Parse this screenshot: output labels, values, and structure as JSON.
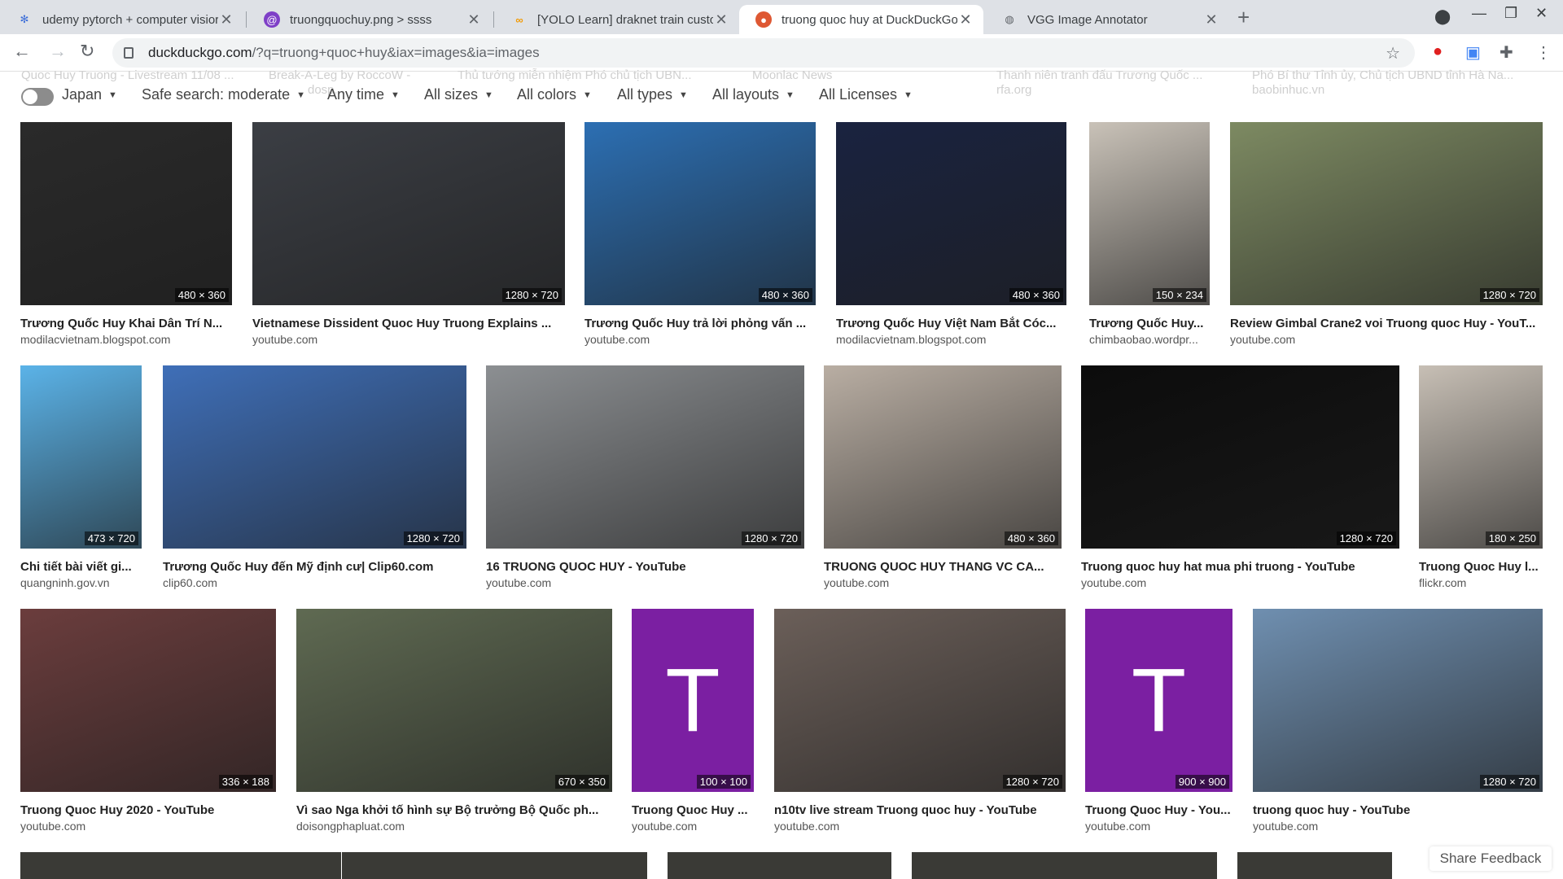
{
  "tabs": [
    {
      "title": "udemy pytorch + computer visior",
      "icon": "gear-icon"
    },
    {
      "title": "truongquochuy.png > ssss",
      "icon": "swirl-icon"
    },
    {
      "title": "[YOLO Learn] draknet train custo",
      "icon": "infinity-icon"
    },
    {
      "title": "truong quoc huy at DuckDuckGo",
      "icon": "duckduckgo-icon",
      "active": true
    },
    {
      "title": "VGG Image Annotator",
      "icon": "globe-icon"
    }
  ],
  "url": {
    "domain": "duckduckgo.com",
    "path": "/?q=truong+quoc+huy&iax=images&ia=images"
  },
  "filters": {
    "region": "Japan",
    "safe": "Safe search: moderate",
    "time": "Any time",
    "size": "All sizes",
    "color": "All colors",
    "type": "All types",
    "layout": "All layouts",
    "license": "All Licenses"
  },
  "ghost_row": [
    "Quoc Huy Truong - Livestream 11/08 ...",
    "Break-A-Leg by RoccoW -",
    "Thủ tướng miễn nhiệm Phó chủ tịch UBN...",
    "Moonlac News",
    "Thanh niên tranh đấu Trương Quốc ...",
    "Phó Bí thư Tỉnh ủy, Chủ tịch UBND tỉnh Hà Na...",
    "dosp...",
    "rfa.org",
    "baobinhuc.vn"
  ],
  "results": [
    {
      "title": "Trương Quốc Huy Khai Dân Trí N...",
      "source": "modilacvietnam.blogspot.com",
      "dims": "480 × 360",
      "bg": "#2a2a2a"
    },
    {
      "title": "Vietnamese Dissident Quoc Huy Truong Explains ...",
      "source": "youtube.com",
      "dims": "1280 × 720",
      "bg": "#3b3e44"
    },
    {
      "title": "Trương Quốc Huy trả lời phỏng vấn ...",
      "source": "youtube.com",
      "dims": "480 × 360",
      "bg": "#2c6fb3"
    },
    {
      "title": "Trương Quốc Huy Việt Nam Bắt Cóc...",
      "source": "modilacvietnam.blogspot.com",
      "dims": "480 × 360",
      "bg": "#1a2340"
    },
    {
      "title": "Trương Quốc Huy...",
      "source": "chimbaobao.wordpr...",
      "dims": "150 × 234",
      "bg": "#c9c2b8"
    },
    {
      "title": "Review Gimbal Crane2 voi Truong quoc Huy - YouT...",
      "source": "youtube.com",
      "dims": "1280 × 720",
      "bg": "#7d8a62"
    },
    {
      "title": "Chi tiết bài viết gi...",
      "source": "quangninh.gov.vn",
      "dims": "473 × 720",
      "bg": "#5bb3e8"
    },
    {
      "title": "Trương Quốc Huy đến Mỹ định cư| Clip60.com",
      "source": "clip60.com",
      "dims": "1280 × 720",
      "bg": "#3f6fb8"
    },
    {
      "title": "16 TRUONG QUOC HUY - YouTube",
      "source": "youtube.com",
      "dims": "1280 × 720",
      "bg": "#8c8f92"
    },
    {
      "title": "TRUONG QUOC HUY THANG VC CA...",
      "source": "youtube.com",
      "dims": "480 × 360",
      "bg": "#b9aea3"
    },
    {
      "title": "Truong quoc huy hat mua phi truong - YouTube",
      "source": "youtube.com",
      "dims": "1280 × 720",
      "bg": "#0c0c0c"
    },
    {
      "title": "Truong Quoc Huy l...",
      "source": "flickr.com",
      "dims": "180 × 250",
      "bg": "#c7bfb5"
    },
    {
      "title": "Truong Quoc Huy 2020 - YouTube",
      "source": "youtube.com",
      "dims": "336 × 188",
      "bg": "#6b3d3d"
    },
    {
      "title": "Vì sao Nga khởi tố hình sự Bộ trưởng Bộ Quốc ph...",
      "source": "doisongphapluat.com",
      "dims": "670 × 350",
      "bg": "#5f6a52"
    },
    {
      "title": "Truong Quoc Huy ...",
      "source": "youtube.com",
      "dims": "100 × 100",
      "letter": "T"
    },
    {
      "title": "n10tv live stream Truong quoc huy - YouTube",
      "source": "youtube.com",
      "dims": "1280 × 720",
      "bg": "#6b5f59"
    },
    {
      "title": "Truong Quoc Huy - You...",
      "source": "youtube.com",
      "dims": "900 × 900",
      "letter": "T"
    },
    {
      "title": "truong quoc huy - YouTube",
      "source": "youtube.com",
      "dims": "1280 × 720",
      "bg": "#6f8fb0"
    }
  ],
  "feedback": "Share Feedback"
}
